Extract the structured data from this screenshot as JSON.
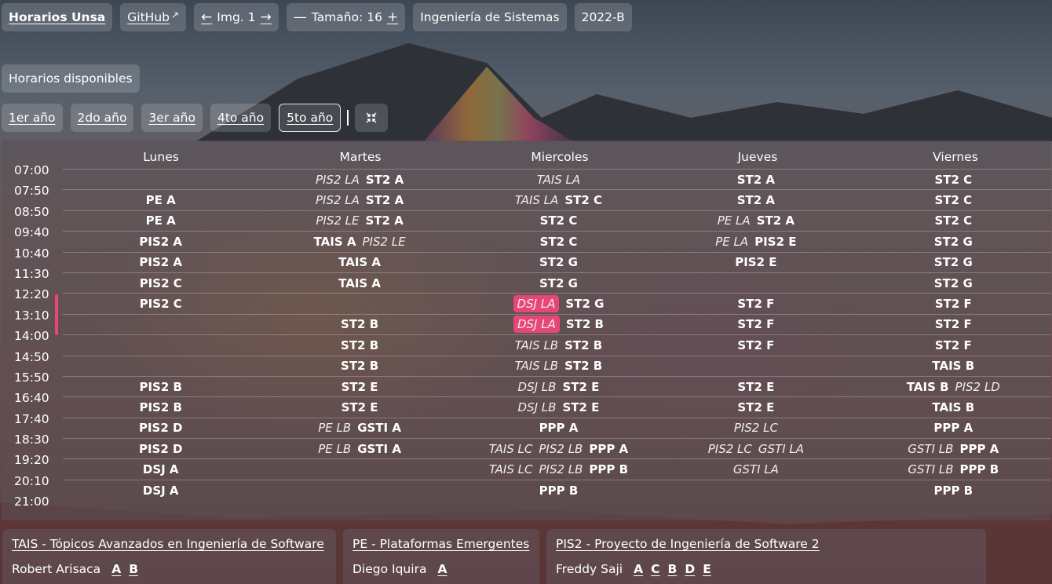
{
  "toolbar": {
    "app_title": "Horarios Unsa",
    "github_label": "GitHub",
    "github_arrow": "↗",
    "prev_icon": "←",
    "img_label": "Img. 1",
    "next_icon": "→",
    "minus_icon": "—",
    "size_label": "Tamaño: 16",
    "plus_icon": "+",
    "career": "Ingeniería de Sistemas",
    "semester": "2022-B"
  },
  "available_label": "Horarios disponibles",
  "years": [
    "1er año",
    "2do año",
    "3er año",
    "4to año",
    "5to año"
  ],
  "selected_year": "5to año",
  "collapse_icon": "⁕",
  "days": [
    "Lunes",
    "Martes",
    "Miercoles",
    "Jueves",
    "Viernes"
  ],
  "times": [
    "07:00",
    "07:50",
    "08:50",
    "09:40",
    "10:40",
    "11:30",
    "12:20",
    "13:10",
    "14:00",
    "14:50",
    "15:50",
    "16:40",
    "17:40",
    "18:30",
    "19:20",
    "20:10",
    "21:00"
  ],
  "schedule": [
    [
      [],
      [
        {
          "t": "PIS2 LA",
          "i": true
        },
        {
          "t": "ST2 A"
        }
      ],
      [
        {
          "t": "TAIS LA",
          "i": true
        }
      ],
      [
        {
          "t": "ST2 A"
        }
      ],
      [
        {
          "t": "ST2 C"
        }
      ]
    ],
    [
      [
        {
          "t": "PE A"
        }
      ],
      [
        {
          "t": "PIS2 LA",
          "i": true
        },
        {
          "t": "ST2 A"
        }
      ],
      [
        {
          "t": "TAIS LA",
          "i": true
        },
        {
          "t": "ST2 C"
        }
      ],
      [
        {
          "t": "ST2 A"
        }
      ],
      [
        {
          "t": "ST2 C"
        }
      ]
    ],
    [
      [
        {
          "t": "PE A"
        }
      ],
      [
        {
          "t": "PIS2 LE",
          "i": true
        },
        {
          "t": "ST2 A"
        }
      ],
      [
        {
          "t": "ST2 C"
        }
      ],
      [
        {
          "t": "PE LA",
          "i": true
        },
        {
          "t": "ST2 A"
        }
      ],
      [
        {
          "t": "ST2 C"
        }
      ]
    ],
    [
      [
        {
          "t": "PIS2 A"
        }
      ],
      [
        {
          "t": "TAIS A"
        },
        {
          "t": "PIS2 LE",
          "i": true
        }
      ],
      [
        {
          "t": "ST2 C"
        }
      ],
      [
        {
          "t": "PE LA",
          "i": true
        },
        {
          "t": "PIS2 E"
        }
      ],
      [
        {
          "t": "ST2 G"
        }
      ]
    ],
    [
      [
        {
          "t": "PIS2 A"
        }
      ],
      [
        {
          "t": "TAIS A"
        }
      ],
      [
        {
          "t": "ST2 G"
        }
      ],
      [
        {
          "t": "PIS2 E"
        }
      ],
      [
        {
          "t": "ST2 G"
        }
      ]
    ],
    [
      [
        {
          "t": "PIS2 C"
        }
      ],
      [
        {
          "t": "TAIS A"
        }
      ],
      [
        {
          "t": "ST2 G"
        }
      ],
      [],
      [
        {
          "t": "ST2 G"
        }
      ]
    ],
    [
      [
        {
          "t": "PIS2 C"
        }
      ],
      [],
      [
        {
          "t": "DSJ LA",
          "i": true,
          "h": true
        },
        {
          "t": "ST2 G"
        }
      ],
      [
        {
          "t": "ST2 F"
        }
      ],
      [
        {
          "t": "ST2 F"
        }
      ]
    ],
    [
      [],
      [
        {
          "t": "ST2 B"
        }
      ],
      [
        {
          "t": "DSJ LA",
          "i": true,
          "h": true
        },
        {
          "t": "ST2 B"
        }
      ],
      [
        {
          "t": "ST2 F"
        }
      ],
      [
        {
          "t": "ST2 F"
        }
      ]
    ],
    [
      [],
      [
        {
          "t": "ST2 B"
        }
      ],
      [
        {
          "t": "TAIS LB",
          "i": true
        },
        {
          "t": "ST2 B"
        }
      ],
      [
        {
          "t": "ST2 F"
        }
      ],
      [
        {
          "t": "ST2 F"
        }
      ]
    ],
    [
      [],
      [
        {
          "t": "ST2 B"
        }
      ],
      [
        {
          "t": "TAIS LB",
          "i": true
        },
        {
          "t": "ST2 B"
        }
      ],
      [],
      [
        {
          "t": "TAIS B"
        }
      ]
    ],
    [
      [
        {
          "t": "PIS2 B"
        }
      ],
      [
        {
          "t": "ST2 E"
        }
      ],
      [
        {
          "t": "DSJ LB",
          "i": true
        },
        {
          "t": "ST2 E"
        }
      ],
      [
        {
          "t": "ST2 E"
        }
      ],
      [
        {
          "t": "TAIS B"
        },
        {
          "t": "PIS2 LD",
          "i": true
        }
      ]
    ],
    [
      [
        {
          "t": "PIS2 B"
        }
      ],
      [
        {
          "t": "ST2 E"
        }
      ],
      [
        {
          "t": "DSJ LB",
          "i": true
        },
        {
          "t": "ST2 E"
        }
      ],
      [
        {
          "t": "ST2 E"
        }
      ],
      [
        {
          "t": "TAIS B"
        }
      ]
    ],
    [
      [
        {
          "t": "PIS2 D"
        }
      ],
      [
        {
          "t": "PE LB",
          "i": true
        },
        {
          "t": "GSTI A"
        }
      ],
      [
        {
          "t": "PPP A"
        }
      ],
      [
        {
          "t": "PIS2 LC",
          "i": true
        }
      ],
      [
        {
          "t": "PPP A"
        }
      ]
    ],
    [
      [
        {
          "t": "PIS2 D"
        }
      ],
      [
        {
          "t": "PE LB",
          "i": true
        },
        {
          "t": "GSTI A"
        }
      ],
      [
        {
          "t": "TAIS LC",
          "i": true
        },
        {
          "t": "PIS2 LB",
          "i": true
        },
        {
          "t": "PPP A"
        }
      ],
      [
        {
          "t": "PIS2 LC",
          "i": true
        },
        {
          "t": "GSTI LA",
          "i": true
        }
      ],
      [
        {
          "t": "GSTI LB",
          "i": true
        },
        {
          "t": "PPP A"
        }
      ]
    ],
    [
      [
        {
          "t": "DSJ A"
        }
      ],
      [],
      [
        {
          "t": "TAIS LC",
          "i": true
        },
        {
          "t": "PIS2 LB",
          "i": true
        },
        {
          "t": "PPP B"
        }
      ],
      [
        {
          "t": "GSTI LA",
          "i": true
        }
      ],
      [
        {
          "t": "GSTI LB",
          "i": true
        },
        {
          "t": "PPP B"
        }
      ]
    ],
    [
      [
        {
          "t": "DSJ A"
        }
      ],
      [],
      [
        {
          "t": "PPP B"
        }
      ],
      [],
      [
        {
          "t": "PPP B"
        }
      ]
    ]
  ],
  "courses": [
    {
      "title": "TAIS - Tópicos Avanzados en Ingeniería de Software",
      "teacher": "Robert Arisaca",
      "groups": [
        "A",
        "B"
      ]
    },
    {
      "title": "PE - Plataformas Emergentes",
      "teacher": "Diego Iquira",
      "groups": [
        "A"
      ]
    },
    {
      "title": "PIS2 - Proyecto de Ingeniería de Software 2",
      "teacher": "Freddy Saji",
      "groups": [
        "A",
        "C",
        "B",
        "D",
        "E"
      ]
    }
  ],
  "colors": {
    "highlight": "#e8457a",
    "now_marker": "#e8457a"
  }
}
